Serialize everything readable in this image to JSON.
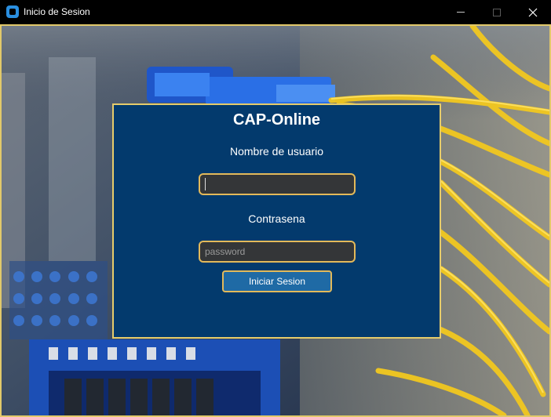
{
  "window": {
    "title": "Inicio de Sesion",
    "icon": "app-icon",
    "controls": [
      "minimize-icon",
      "maximize-icon",
      "close-icon"
    ]
  },
  "login": {
    "title": "CAP-Online",
    "username_label": "Nombre de usuario",
    "username_value": "",
    "password_label": "Contrasena",
    "password_placeholder": "password",
    "submit_label": "Iniciar Sesion"
  },
  "colors": {
    "panel": "#033a6d",
    "border_accent": "#e6cc6b",
    "button": "#1f6aa5",
    "field_bg": "#343638"
  }
}
